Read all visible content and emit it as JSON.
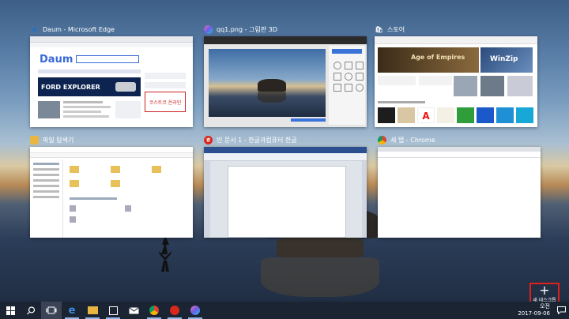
{
  "windows": [
    {
      "title": "Daum - Microsoft Edge",
      "icon": "edge-icon",
      "color": "#1e6fd0"
    },
    {
      "title": "qq1.png - 그림판 3D",
      "icon": "paint3d-icon",
      "color": "#8f63d6"
    },
    {
      "title": "스토어",
      "icon": "store-icon",
      "color": "#2a2a2a"
    },
    {
      "title": "파일 탐색기",
      "icon": "folder-icon",
      "color": "#e9b741"
    },
    {
      "title": "빈 문서 1 - 한글과컴퓨터 한글",
      "icon": "hwp-icon",
      "color": "#d8281c"
    },
    {
      "title": "새 탭 - Chrome",
      "icon": "chrome-icon",
      "color": "#2e9e4b"
    }
  ],
  "edge_thumb": {
    "logo": "Daum",
    "banner": "FORD EXPLORER",
    "ad": "코스트코 온라인"
  },
  "store_thumb": {
    "hero": "Age of Empires",
    "tile": "WinZip"
  },
  "new_desktop": {
    "label": "새 데스크톱"
  },
  "taskbar": {
    "clock_time": "오전",
    "clock_date": "2017-09-06"
  }
}
